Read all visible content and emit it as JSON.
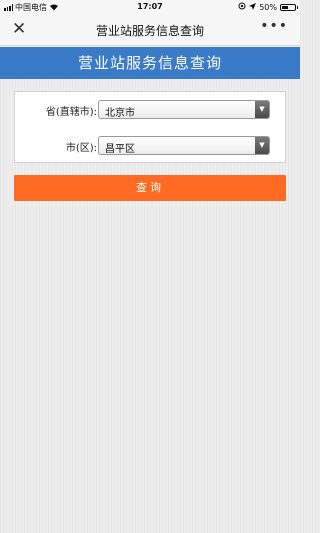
{
  "status_bar": {
    "carrier": "中国电信",
    "time": "17:07",
    "battery_percent": "50%",
    "battery_level": 0.5
  },
  "nav": {
    "title": "营业站服务信息查询",
    "close_icon": "close-icon",
    "more_icon": "more-icon"
  },
  "header": {
    "title": "营业站服务信息查询",
    "color": "#3a7bc8"
  },
  "form": {
    "province_label": "省(直辖市):",
    "province_value": "北京市",
    "city_label": "市(区):",
    "city_value": "昌平区"
  },
  "query_button": {
    "label": "查询",
    "color": "#ff6b23"
  }
}
